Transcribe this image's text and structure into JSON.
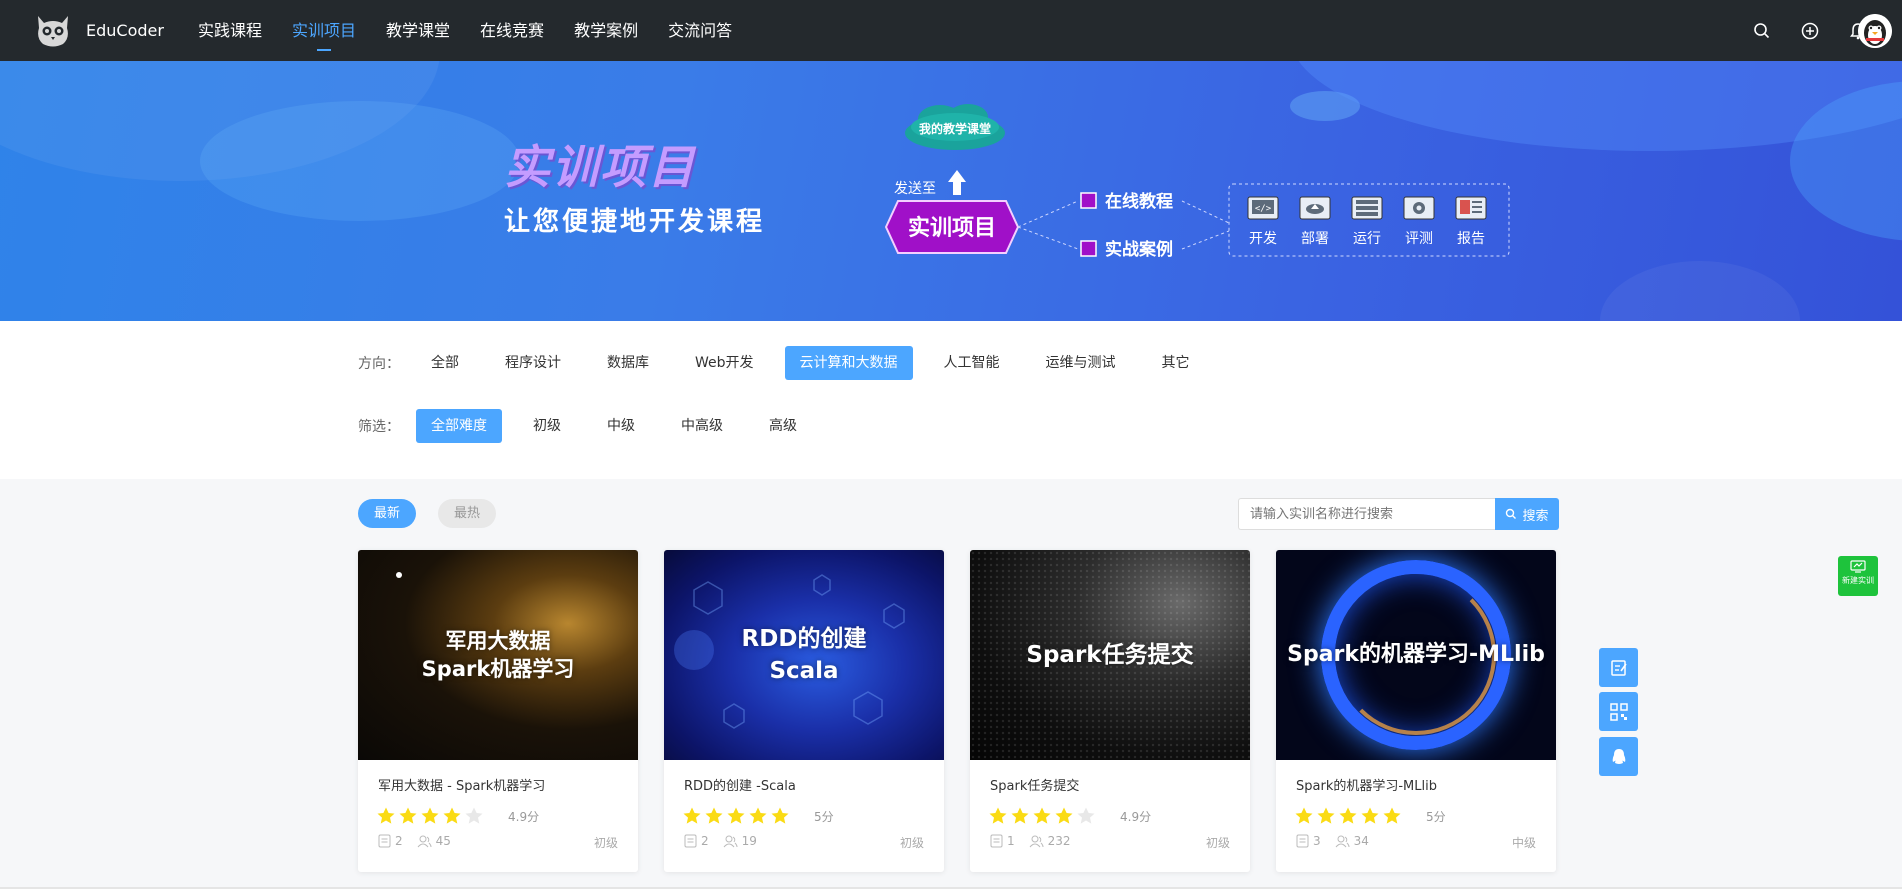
{
  "nav": {
    "brand": "EduCoder",
    "links": [
      "实践课程",
      "实训项目",
      "教学课堂",
      "在线竞赛",
      "教学案例",
      "交流问答"
    ],
    "active_index": 1
  },
  "banner": {
    "title": "实训项目",
    "subtitle": "让您便捷地开发课程",
    "cloud_label": "我的教学课堂",
    "send_to": "发送至",
    "center_label": "实训项目",
    "branches": [
      "在线教程",
      "实战案例"
    ],
    "features": [
      "开发",
      "部署",
      "运行",
      "评测",
      "报告"
    ]
  },
  "filters": {
    "direction_label": "方向：",
    "directions": [
      "全部",
      "程序设计",
      "数据库",
      "Web开发",
      "云计算和大数据",
      "人工智能",
      "运维与测试",
      "其它"
    ],
    "direction_active": 4,
    "difficulty_label": "筛选：",
    "difficulties": [
      "全部难度",
      "初级",
      "中级",
      "中高级",
      "高级"
    ],
    "difficulty_active": 0
  },
  "sort": {
    "newest": "最新",
    "hottest": "最热"
  },
  "search": {
    "placeholder": "请输入实训名称进行搜索",
    "button": "搜索"
  },
  "cards": [
    {
      "image_text": "军用大数据\nSpark机器学习",
      "title": "军用大数据 - Spark机器学习",
      "rating": 4,
      "score": "4.9分",
      "stages": "2",
      "learners": "45",
      "level": "初级"
    },
    {
      "image_text": "RDD的创建\nScala",
      "title": "RDD的创建 -Scala",
      "rating": 5,
      "score": "5分",
      "stages": "2",
      "learners": "19",
      "level": "初级"
    },
    {
      "image_text": "Spark任务提交",
      "title": "Spark任务提交",
      "rating": 4,
      "score": "4.9分",
      "stages": "1",
      "learners": "232",
      "level": "初级"
    },
    {
      "image_text": "Spark的机器学习-MLlib",
      "title": "Spark的机器学习-MLlib",
      "rating": 5,
      "score": "5分",
      "stages": "3",
      "learners": "34",
      "level": "中级"
    }
  ],
  "side_new": "新建实训",
  "colors": {
    "accent": "#4ca6ff",
    "nav_bg": "#24292d",
    "star": "#fadb14",
    "green": "#1ec33c",
    "purple": "#a010c8"
  }
}
